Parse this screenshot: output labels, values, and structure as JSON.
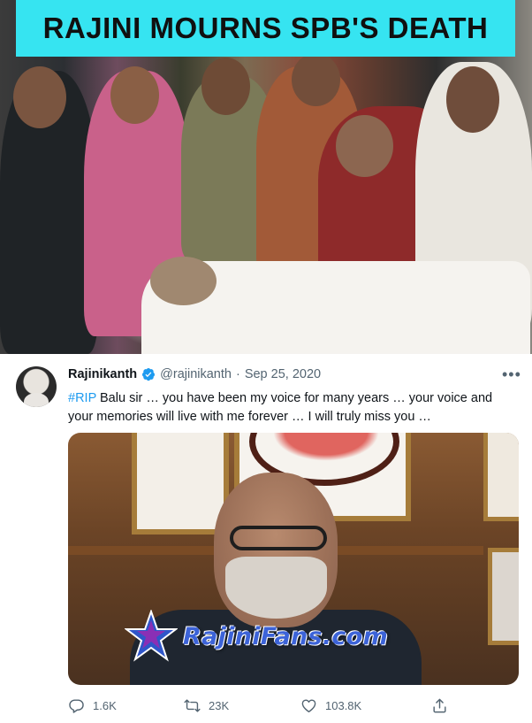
{
  "headline": "RAJINI MOURNS SPB'S DEATH",
  "colors": {
    "banner_bg": "#36e4f1",
    "twitter_blue": "#1d9bf0",
    "muted": "#536471",
    "watermark_blue": "#3c63d8"
  },
  "tweet": {
    "display_name": "Rajinikanth",
    "verified_icon": "verified-badge-icon",
    "handle": "@rajinikanth",
    "separator": "·",
    "date": "Sep 25, 2020",
    "more_icon": "more-options-icon",
    "hashtag": "#RIP",
    "text": " Balu sir … you have been my voice for many years … your voice and your memories will live with me forever … I will truly miss you …",
    "media_watermark": "RajiniFans.com",
    "actions": {
      "reply": {
        "icon": "reply-icon",
        "count": "1.6K"
      },
      "retweet": {
        "icon": "retweet-icon",
        "count": "23K"
      },
      "like": {
        "icon": "heart-icon",
        "count": "103.8K"
      },
      "share": {
        "icon": "share-icon"
      }
    }
  }
}
